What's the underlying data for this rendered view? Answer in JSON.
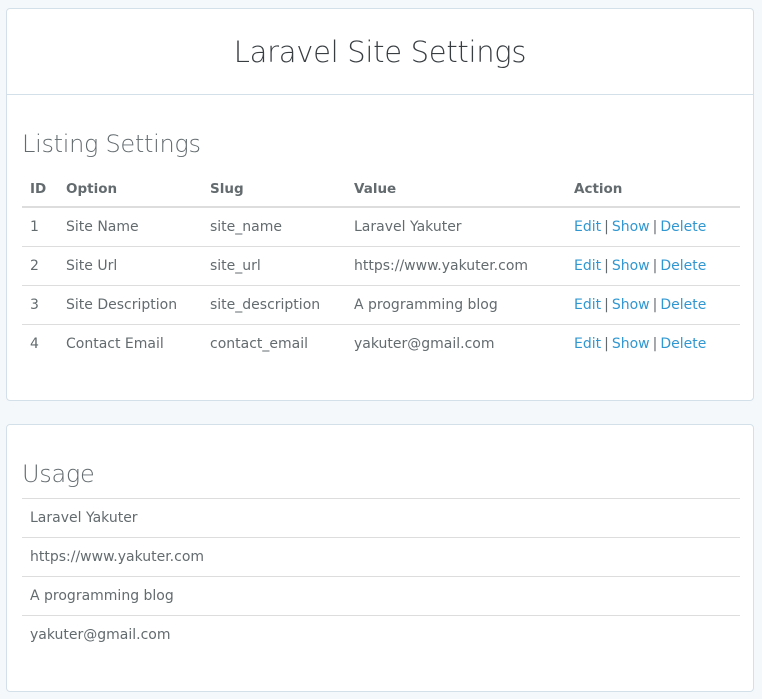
{
  "page": {
    "title": "Laravel Site Settings"
  },
  "listing": {
    "title": "Listing Settings",
    "columns": {
      "id": "ID",
      "option": "Option",
      "slug": "Slug",
      "value": "Value",
      "action": "Action"
    },
    "rows": [
      {
        "id": "1",
        "option": "Site Name",
        "slug": "site_name",
        "value": "Laravel Yakuter",
        "edit": "Edit",
        "show": "Show",
        "delete": "Delete"
      },
      {
        "id": "2",
        "option": "Site Url",
        "slug": "site_url",
        "value": "https://www.yakuter.com",
        "edit": "Edit",
        "show": "Show",
        "delete": "Delete"
      },
      {
        "id": "3",
        "option": "Site Description",
        "slug": "site_description",
        "value": "A programming blog",
        "edit": "Edit",
        "show": "Show",
        "delete": "Delete"
      },
      {
        "id": "4",
        "option": "Contact Email",
        "slug": "contact_email",
        "value": "yakuter@gmail.com",
        "edit": "Edit",
        "show": "Show",
        "delete": "Delete"
      }
    ],
    "separator": "|"
  },
  "usage": {
    "title": "Usage",
    "items": [
      "Laravel Yakuter",
      "https://www.yakuter.com",
      "A programming blog",
      "yakuter@gmail.com"
    ]
  },
  "colors": {
    "background": "#f5f8fa",
    "link": "#3097d1",
    "text": "#636b6f",
    "border": "#d3e0e9"
  }
}
